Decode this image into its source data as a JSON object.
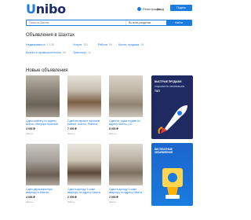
{
  "header": {
    "logo_prefix": "U",
    "logo_rest": "nibo",
    "register": "Регистрация",
    "login_link": "Вход",
    "post_ad_button": "Подать объявление"
  },
  "search": {
    "placeholder": "Поиск в Шахтах",
    "region": "Во всех разделах",
    "button": "Найти"
  },
  "page_title": "Объявления в Шахтах",
  "categories": [
    {
      "label": "Недвижимость",
      "count": "1 136"
    },
    {
      "label": "Услуги",
      "count": "151"
    },
    {
      "label": "Работа",
      "count": "56"
    },
    {
      "label": "Купля, продажа",
      "count": "16"
    },
    {
      "label": "Бизнес и промышленность",
      "count": "56"
    },
    {
      "label": "Транспорт",
      "count": "11"
    }
  ],
  "section_title": "Новые объявления",
  "listings": [
    {
      "title": "Сдам комнату по адресу Шахты, Микрорн Красный",
      "price": "4 000 ₽",
      "location": "Шахты"
    },
    {
      "title": "Сдаётся гараж в хорошем районе, Шахты, Рыбина, 19",
      "price": "7 000 ₽",
      "location": "Шахты"
    },
    {
      "title": "Сдается, сдам студию по адресу Шахты, р-н Хабаровская",
      "price": "8 000 ₽",
      "location": "Шахты"
    },
    {
      "title": "Сдам квартиру по адресу Шахты, ул. Харьковская",
      "price": "6 000 ₽",
      "location": "Шахты"
    },
    {
      "title": "Сдам двухкомнатную квартиру в Шахтах",
      "price": "4 000 ₽",
      "location": "Шахты"
    },
    {
      "title": "Сдам в аренду 1-комн квартиру по адресу Шахты",
      "price": "2 000 ₽",
      "location": "Шахты"
    },
    {
      "title": "Сдам в аренду 1-комн квартиру по адресу Шахты",
      "price": "2 000 ₽",
      "location": "Шахты"
    },
    {
      "title": "Сдам в аренду 1-комн квартиру по адресу Шахты",
      "price": "8 000 ₽",
      "location": "Шахты"
    }
  ],
  "banner1": {
    "line1": "БЫСТРЫЕ ПРОДАЖИ",
    "line2": "ПОДНИМИТЕ ОБЪЯВЛЕНИЕ",
    "line3": "ТОП"
  },
  "banner2": {
    "line1": "БЕСПЛАТНЫЕ",
    "line2": "ОБЪЯВЛЕНИЯ"
  },
  "colors": {
    "accent": "#1a7be0",
    "logo_dark": "#1a2a6c",
    "banner_dark": "#1f2a63"
  }
}
